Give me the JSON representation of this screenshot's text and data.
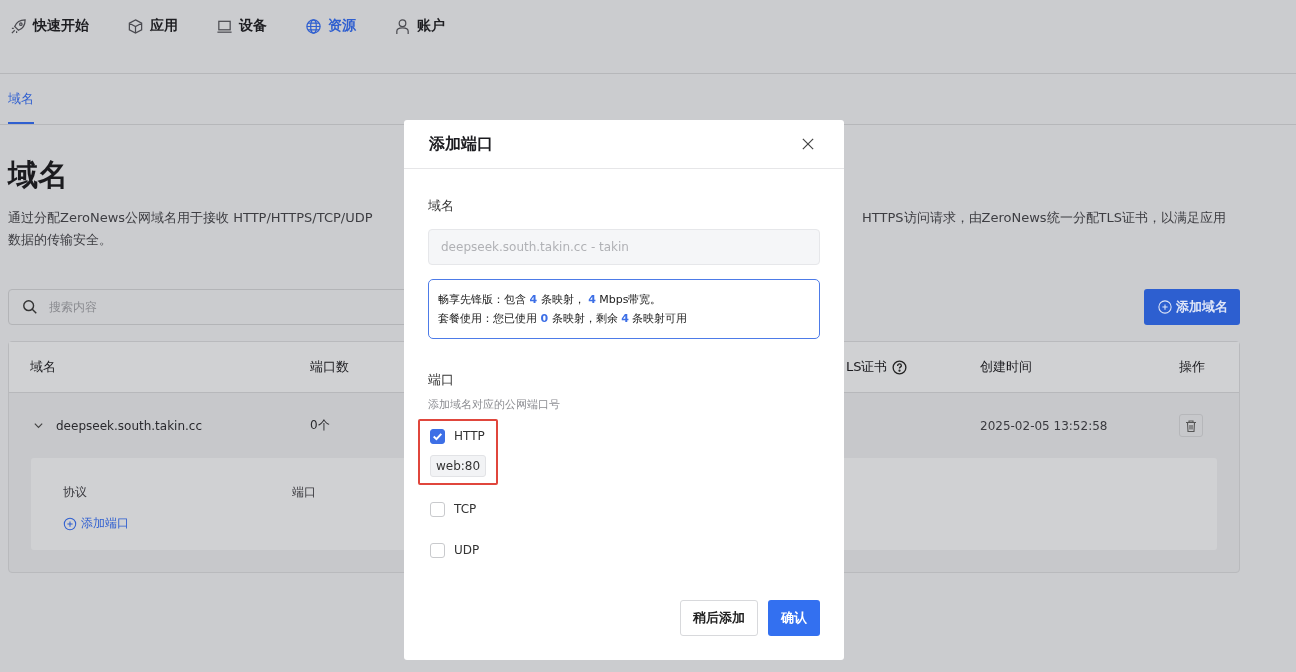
{
  "nav": [
    {
      "label": "快速开始",
      "kind": "rocket",
      "selected": false
    },
    {
      "label": "应用",
      "kind": "cube",
      "selected": false
    },
    {
      "label": "设备",
      "kind": "laptop",
      "selected": false
    },
    {
      "label": "资源",
      "kind": "globe",
      "selected": true
    },
    {
      "label": "账户",
      "kind": "person",
      "selected": false
    }
  ],
  "tabs": [
    {
      "label": "域名",
      "selected": true
    }
  ],
  "page": {
    "title": "域名",
    "description_line_1": [
      "通过分配ZeroNews公网域名用于接收 HTTP/HTTPS/TCP/UDP",
      "HTTPS访问请求，由ZeroNews统一分配TLS证书，以满足应用"
    ],
    "description_line_2": "数据的传输安全。",
    "search": {
      "placeholder": "搜索内容"
    },
    "add_button": "添加域名"
  },
  "table": {
    "columns": [
      {
        "label": "域名",
        "help": false
      },
      {
        "label": "端口数",
        "help": false
      },
      {
        "label": "LS证书",
        "help": true
      },
      {
        "label": "创建时间",
        "help": false
      },
      {
        "label": "操作",
        "help": false
      }
    ],
    "rows": [
      {
        "expanded": true,
        "domain": "deepseek.south.takin.cc",
        "ports": "0个",
        "created": "2025-02-05 13:52:58",
        "detail_columns": [
          "协议",
          "端口"
        ],
        "add_link": "添加端口"
      }
    ]
  },
  "dialog": {
    "title": "添加端口",
    "domain_label": "域名",
    "domain_value": "deepseek.south.takin.cc - takin",
    "plan_lines": [
      [
        {
          "text": "畅享先锋版：包含 ",
          "highlight": false
        },
        {
          "text": "4",
          "highlight": true
        },
        {
          "text": " 条映射， ",
          "highlight": false
        },
        {
          "text": "4",
          "highlight": true
        },
        {
          "text": " Mbps带宽。",
          "highlight": false
        }
      ],
      [
        {
          "text": "套餐使用：您已使用 ",
          "highlight": false
        },
        {
          "text": "0",
          "highlight": true
        },
        {
          "text": " 条映射，剩余 ",
          "highlight": false
        },
        {
          "text": "4",
          "highlight": true
        },
        {
          "text": " 条映射可用",
          "highlight": false
        }
      ]
    ],
    "port_label": "端口",
    "port_hint": "添加域名对应的公网端口号",
    "options": [
      {
        "label": "HTTP",
        "checked": true,
        "marked": true,
        "tags": [
          "web:80"
        ]
      },
      {
        "label": "TCP",
        "checked": false,
        "marked": false
      },
      {
        "label": "UDP",
        "checked": false,
        "marked": false
      }
    ],
    "buttons": [
      {
        "label": "稍后添加",
        "kind": "secondary"
      },
      {
        "label": "确认",
        "kind": "primary"
      }
    ]
  }
}
